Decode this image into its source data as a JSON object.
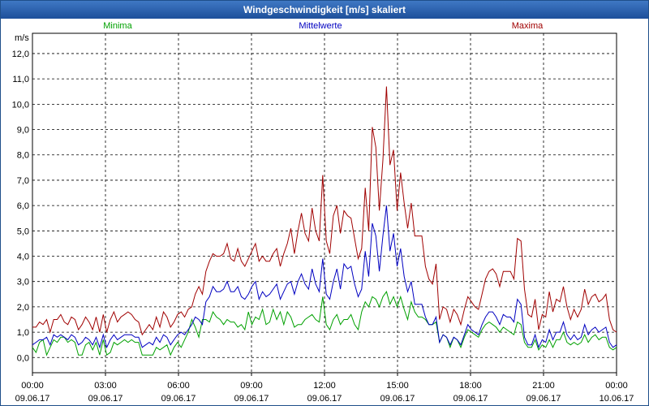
{
  "window": {
    "title": "Windgeschwindigkeit [m/s] skaliert"
  },
  "chart_data": {
    "type": "line",
    "title": "Windgeschwindigkeit [m/s] skaliert",
    "ylabel": "m/s",
    "xlabel": "",
    "ylim": [
      -0.6,
      12.8
    ],
    "xlim_hours": [
      0,
      24
    ],
    "grid": true,
    "y_ticks": [
      "0,0",
      "1,0",
      "2,0",
      "3,0",
      "4,0",
      "5,0",
      "6,0",
      "7,0",
      "8,0",
      "9,0",
      "10,0",
      "11,0",
      "12,0"
    ],
    "x_ticks": [
      {
        "time": "00:00",
        "date": "09.06.17"
      },
      {
        "time": "03:00",
        "date": "09.06.17"
      },
      {
        "time": "06:00",
        "date": "09.06.17"
      },
      {
        "time": "09:00",
        "date": "09.06.17"
      },
      {
        "time": "12:00",
        "date": "09.06.17"
      },
      {
        "time": "15:00",
        "date": "09.06.17"
      },
      {
        "time": "18:00",
        "date": "09.06.17"
      },
      {
        "time": "21:00",
        "date": "09.06.17"
      },
      {
        "time": "00:00",
        "date": "10.06.17"
      }
    ],
    "series": [
      {
        "name": "Minima",
        "color": "#00a000",
        "values": [
          0.4,
          0.2,
          0.6,
          0.7,
          0.1,
          0.4,
          0.7,
          0.6,
          0.8,
          0.8,
          0.6,
          0.7,
          0.6,
          0.1,
          0.1,
          0.5,
          0.6,
          0.3,
          0.6,
          0.1,
          0.7,
          0.1,
          0.2,
          0.6,
          0.5,
          0.6,
          0.7,
          0.6,
          0.7,
          0.6,
          0.6,
          0.1,
          0.1,
          0.1,
          0.1,
          0.4,
          0.3,
          0.4,
          0.5,
          0.1,
          0.4,
          0.6,
          0.4,
          0.7,
          1.0,
          1.5,
          1.2,
          0.8,
          1.5,
          1.5,
          1.4,
          1.8,
          1.6,
          1.5,
          1.3,
          1.5,
          1.4,
          1.4,
          1.2,
          1.3,
          1.1,
          1.8,
          1.3,
          1.6,
          1.5,
          1.9,
          1.3,
          1.4,
          1.9,
          1.5,
          1.8,
          1.3,
          1.8,
          1.6,
          1.2,
          1.3,
          1.3,
          1.5,
          1.6,
          1.7,
          1.5,
          1.4,
          2.4,
          1.3,
          1.1,
          1.5,
          1.7,
          1.3,
          1.5,
          1.5,
          1.7,
          1.3,
          1.1,
          1.8,
          2.2,
          2.0,
          2.4,
          2.3,
          2.0,
          2.4,
          2.6,
          2.1,
          2.4,
          2.0,
          2.4,
          1.9,
          1.5,
          2.2,
          1.8,
          1.6,
          1.6,
          1.5,
          1.3,
          1.3,
          1.4,
          0.6,
          0.9,
          0.8,
          0.4,
          0.8,
          0.7,
          0.4,
          0.8,
          1.1,
          1.0,
          0.9,
          0.8,
          1.1,
          1.3,
          1.4,
          1.3,
          1.2,
          1.0,
          1.2,
          1.1,
          1.0,
          0.9,
          1.4,
          1.3,
          0.6,
          0.4,
          0.4,
          0.7,
          0.3,
          0.5,
          0.4,
          0.7,
          0.4,
          0.7,
          0.7,
          1.0,
          0.6,
          0.5,
          0.6,
          0.5,
          0.6,
          0.9,
          0.6,
          0.8,
          0.9,
          0.7,
          0.8,
          0.8,
          0.4,
          0.3,
          0.4
        ]
      },
      {
        "name": "Mittelwerte",
        "color": "#0000c0",
        "values": [
          0.5,
          0.6,
          0.7,
          0.7,
          0.8,
          0.5,
          0.9,
          0.8,
          0.9,
          0.8,
          0.7,
          0.9,
          0.8,
          0.5,
          0.6,
          0.8,
          0.7,
          0.5,
          0.8,
          0.4,
          0.9,
          0.4,
          0.7,
          0.9,
          0.7,
          0.8,
          0.9,
          0.9,
          0.9,
          0.8,
          0.8,
          0.4,
          0.5,
          0.6,
          0.5,
          0.8,
          0.6,
          0.9,
          0.8,
          0.5,
          0.7,
          0.9,
          1.0,
          0.9,
          1.1,
          1.3,
          1.6,
          1.5,
          1.3,
          2.2,
          2.4,
          2.8,
          2.6,
          2.6,
          2.7,
          3.0,
          2.6,
          2.6,
          2.8,
          2.4,
          2.3,
          2.5,
          2.8,
          3.0,
          2.3,
          2.6,
          2.4,
          2.5,
          2.7,
          2.9,
          2.3,
          2.6,
          2.9,
          3.0,
          2.5,
          3.0,
          3.3,
          2.9,
          2.7,
          3.5,
          2.9,
          2.6,
          3.9,
          2.5,
          2.3,
          3.0,
          3.5,
          2.7,
          3.7,
          3.5,
          3.6,
          2.9,
          2.4,
          2.7,
          4.2,
          3.2,
          5.3,
          4.8,
          3.4,
          4.8,
          6.0,
          4.2,
          4.9,
          3.6,
          4.3,
          3.2,
          2.6,
          3.0,
          2.1,
          2.1,
          2.1,
          1.6,
          1.3,
          1.3,
          1.6,
          0.6,
          0.9,
          0.8,
          0.5,
          0.8,
          0.7,
          0.5,
          0.9,
          1.3,
          1.1,
          1.0,
          0.9,
          1.3,
          1.6,
          1.8,
          1.8,
          1.6,
          1.3,
          1.7,
          1.6,
          1.6,
          1.4,
          2.3,
          2.1,
          0.8,
          0.5,
          0.5,
          0.9,
          0.4,
          0.7,
          0.6,
          1.1,
          0.7,
          1.0,
          1.0,
          1.4,
          0.9,
          0.7,
          0.9,
          0.7,
          0.8,
          1.3,
          0.9,
          1.1,
          1.2,
          1.0,
          1.1,
          1.2,
          0.6,
          0.4,
          0.5
        ]
      },
      {
        "name": "Maxima",
        "color": "#a00000",
        "values": [
          1.2,
          1.2,
          1.4,
          1.3,
          1.5,
          1.0,
          1.5,
          1.5,
          1.7,
          1.4,
          1.3,
          1.6,
          1.5,
          1.1,
          1.3,
          1.6,
          1.4,
          1.1,
          1.6,
          1.0,
          1.7,
          1.0,
          1.5,
          1.8,
          1.4,
          1.6,
          1.7,
          1.8,
          1.7,
          1.5,
          1.4,
          0.9,
          1.1,
          1.3,
          1.1,
          1.6,
          1.2,
          1.8,
          1.6,
          1.2,
          1.4,
          1.7,
          1.8,
          1.6,
          1.9,
          2.0,
          2.5,
          2.8,
          2.5,
          3.4,
          3.8,
          4.1,
          4.0,
          4.0,
          4.1,
          4.5,
          3.9,
          3.8,
          4.3,
          3.8,
          3.6,
          3.9,
          4.2,
          4.5,
          3.8,
          4.0,
          3.8,
          3.8,
          4.1,
          4.3,
          3.6,
          4.1,
          4.5,
          5.1,
          4.1,
          5.0,
          5.7,
          4.9,
          4.6,
          5.9,
          5.0,
          4.6,
          7.2,
          4.6,
          4.1,
          5.6,
          6.0,
          4.9,
          5.8,
          5.6,
          5.5,
          4.7,
          3.9,
          4.3,
          6.7,
          5.0,
          9.1,
          8.3,
          5.8,
          7.8,
          10.7,
          7.6,
          8.2,
          5.8,
          7.3,
          6.1,
          5.1,
          6.1,
          4.8,
          4.8,
          4.8,
          3.6,
          3.1,
          2.9,
          3.7,
          1.5,
          2.0,
          1.9,
          1.4,
          1.9,
          1.7,
          1.3,
          1.9,
          2.4,
          2.2,
          2.0,
          1.9,
          2.5,
          3.1,
          3.4,
          3.5,
          3.3,
          2.8,
          3.4,
          3.4,
          3.4,
          3.1,
          4.7,
          4.6,
          2.7,
          1.7,
          1.6,
          2.3,
          1.1,
          1.7,
          1.6,
          2.6,
          1.8,
          2.3,
          2.2,
          2.8,
          2.0,
          1.5,
          1.9,
          1.6,
          1.9,
          2.7,
          2.1,
          2.4,
          2.5,
          2.2,
          2.3,
          2.5,
          1.5,
          1.1,
          1.0
        ]
      }
    ]
  }
}
